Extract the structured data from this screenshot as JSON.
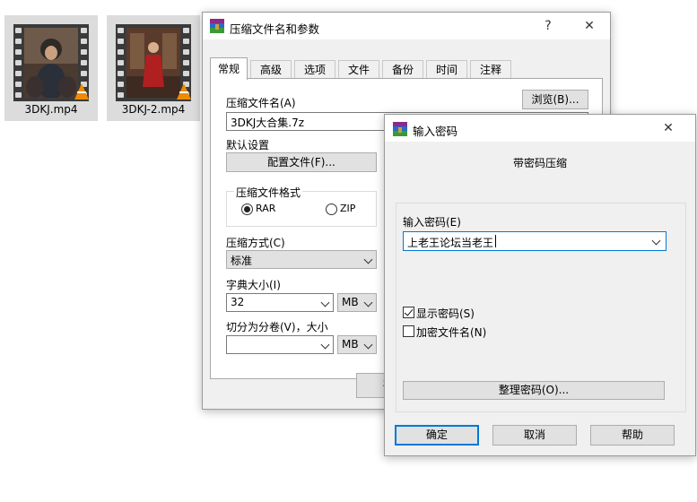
{
  "files": [
    {
      "name": "3DKJ.mp4"
    },
    {
      "name": "3DKJ-2.mp4"
    }
  ],
  "main_dialog": {
    "title": "压缩文件名和参数",
    "help_glyph": "?",
    "close_glyph": "✕",
    "tabs": [
      {
        "label": "常规",
        "active": true
      },
      {
        "label": "高级"
      },
      {
        "label": "选项"
      },
      {
        "label": "文件"
      },
      {
        "label": "备份"
      },
      {
        "label": "时间"
      },
      {
        "label": "注释"
      }
    ],
    "archive_name_label": "压缩文件名(A)",
    "browse_label": "浏览(B)...",
    "archive_name_value": "3DKJ大合集.7z",
    "default_settings_label": "默认设置",
    "profiles_label": "配置文件(F)...",
    "format_group_label": "压缩文件格式",
    "format_options": [
      {
        "label": "RAR",
        "selected": true
      },
      {
        "label": "ZIP",
        "selected": false
      }
    ],
    "method_label": "压缩方式(C)",
    "method_value": "标准",
    "dict_label": "字典大小(I)",
    "dict_value": "32",
    "dict_unit": "MB",
    "split_label": "切分为分卷(V)，大小",
    "split_value": "",
    "split_unit": "MB",
    "ok_partial": "确"
  },
  "password_dialog": {
    "title": "输入密码",
    "close_glyph": "✕",
    "heading": "带密码压缩",
    "password_label": "输入密码(E)",
    "password_value": "上老王论坛当老王",
    "show_password_label": "显示密码(S)",
    "show_password_checked": true,
    "encrypt_names_label": "加密文件名(N)",
    "encrypt_names_checked": false,
    "organize_label": "整理密码(O)...",
    "ok_label": "确定",
    "cancel_label": "取消",
    "help_label": "帮助"
  },
  "colors": {
    "accent": "#0078d7",
    "dialog_bg": "#f0f0f0",
    "tile_bg": "#dcdcdc"
  }
}
